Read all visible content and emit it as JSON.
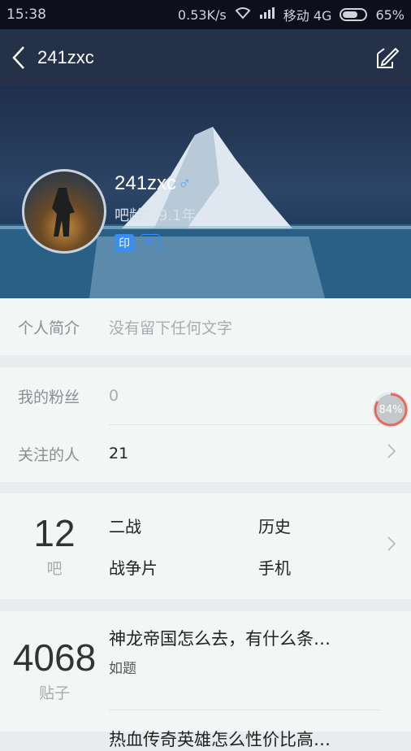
{
  "status_bar": {
    "time": "15:38",
    "net_speed": "0.53K/s",
    "carrier": "移动 4G",
    "battery": "65%"
  },
  "nav": {
    "title": "241zxc",
    "back_icon": "chevron-left-icon",
    "share_icon": "edit-share-icon"
  },
  "profile": {
    "username": "241zxc",
    "gender_symbol": "♂",
    "age": "吧龄：9.1年",
    "badges": [
      "印",
      "✉"
    ]
  },
  "bio": {
    "label": "个人简介",
    "value": "没有留下任何文字"
  },
  "social": {
    "fans_label": "我的粉丝",
    "fans_value": "0",
    "following_label": "关注的人",
    "following_value": "21"
  },
  "bars": {
    "count": "12",
    "unit": "吧",
    "tags": [
      "二战",
      "历史",
      "战争片",
      "手机"
    ]
  },
  "posts": {
    "count": "4068",
    "unit": "贴子",
    "items": [
      {
        "title": "神龙帝国怎么去，有什么条…",
        "sub": "如题"
      },
      {
        "title": "热血传奇英雄怎么性价比高…",
        "sub": ""
      }
    ]
  },
  "progress_badge": "84%"
}
